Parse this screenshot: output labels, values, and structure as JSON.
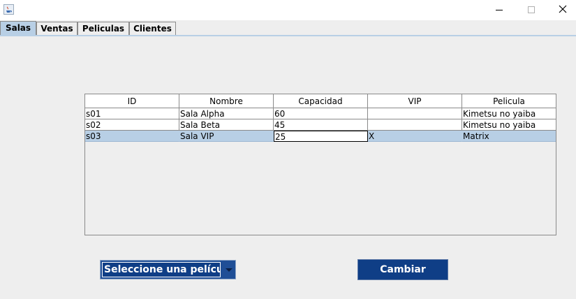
{
  "window": {
    "minimize_glyph": "—",
    "maximize_glyph": "☐",
    "close_glyph": "✕"
  },
  "tabs": [
    {
      "label": "Salas",
      "selected": true
    },
    {
      "label": "Ventas",
      "selected": false
    },
    {
      "label": "Peliculas",
      "selected": false
    },
    {
      "label": "Clientes",
      "selected": false
    }
  ],
  "table": {
    "columns": [
      "ID",
      "Nombre",
      "Capacidad",
      "VIP",
      "Pelicula"
    ],
    "rows": [
      {
        "id": "s01",
        "nombre": "Sala Alpha",
        "capacidad": "60",
        "vip": "",
        "pelicula": "Kimetsu no yaiba"
      },
      {
        "id": "s02",
        "nombre": "Sala Beta",
        "capacidad": "45",
        "vip": "",
        "pelicula": "Kimetsu no yaiba"
      },
      {
        "id": "s03",
        "nombre": "Sala VIP",
        "capacidad": "25",
        "vip": "X",
        "pelicula": "Matrix"
      }
    ]
  },
  "controls": {
    "movie_select_value": "Seleccione una película",
    "change_button": "Cambiar"
  },
  "colors": {
    "selection": "#b8cfe5",
    "button": "#0f3e86"
  }
}
